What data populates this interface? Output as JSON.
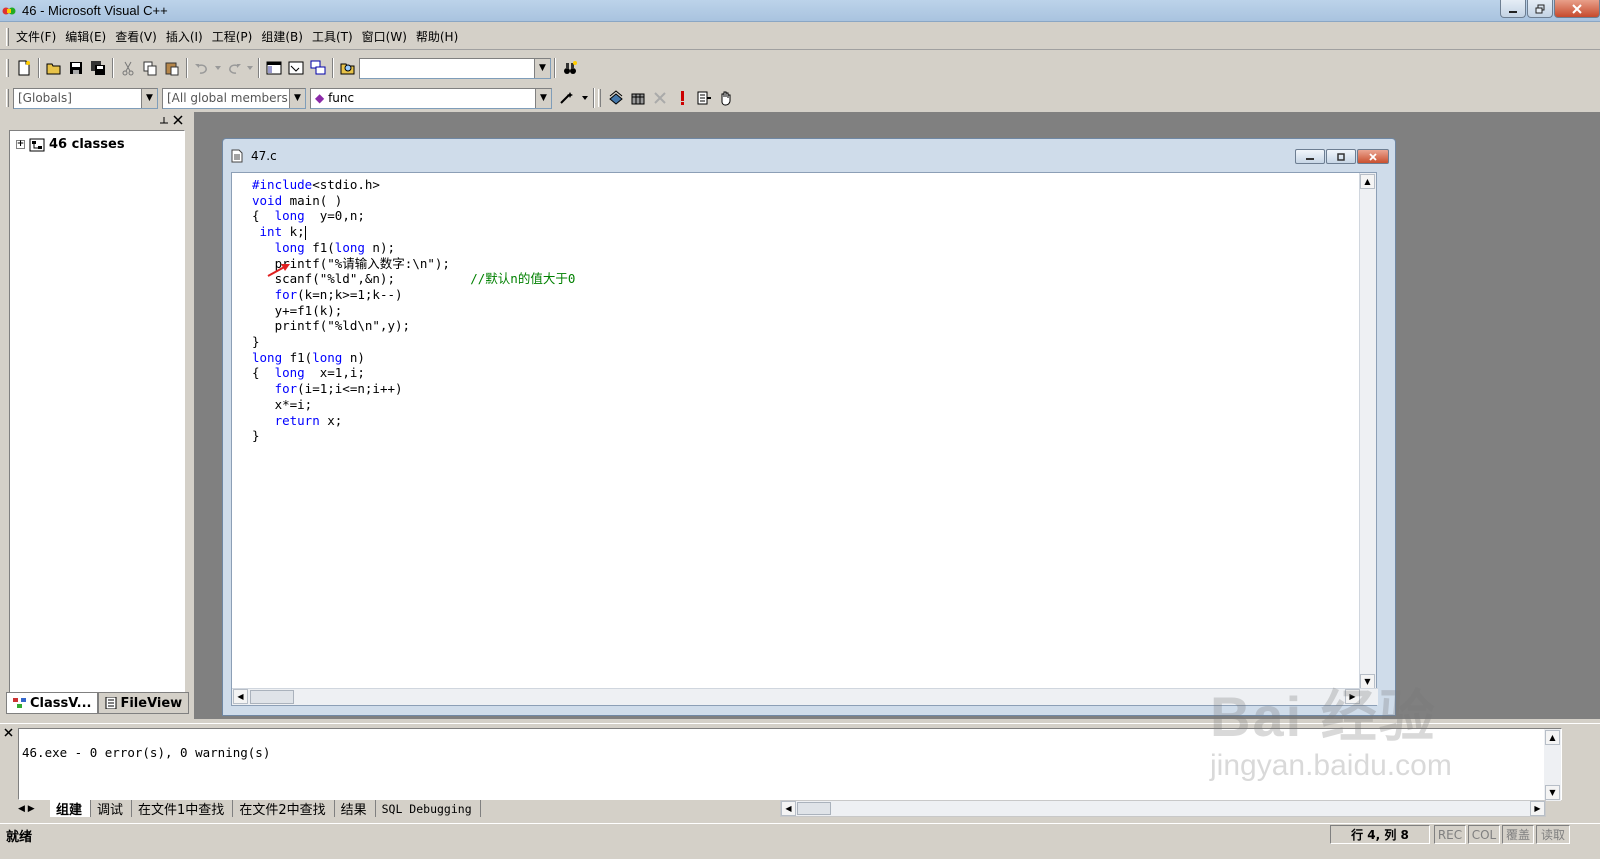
{
  "window": {
    "title": "46 - Microsoft Visual C++"
  },
  "menu": [
    "文件(F)",
    "编辑(E)",
    "查看(V)",
    "插入(I)",
    "工程(P)",
    "组建(B)",
    "工具(T)",
    "窗口(W)",
    "帮助(H)"
  ],
  "wizard": {
    "scope": "[Globals]",
    "filter": "[All global members",
    "member": "func"
  },
  "workspace": {
    "tree_root": "46 classes",
    "tabs": [
      "ClassV...",
      "FileView"
    ],
    "active_tab": "ClassV..."
  },
  "editor": {
    "file": "47.c"
  },
  "code_lines": [
    {
      "seg": [
        {
          "t": "#include",
          "k": "kw"
        },
        {
          "t": "<stdio.h>"
        }
      ]
    },
    {
      "seg": [
        {
          "t": "void",
          "k": "kw"
        },
        {
          "t": " main( )"
        }
      ]
    },
    {
      "seg": [
        {
          "t": "{  "
        },
        {
          "t": "long",
          "k": "kw"
        },
        {
          "t": "  y=0,n;"
        }
      ]
    },
    {
      "seg": [
        {
          "t": " "
        },
        {
          "t": "int",
          "k": "kw"
        },
        {
          "t": " k;"
        }
      ],
      "cursor": true
    },
    {
      "seg": [
        {
          "t": "   "
        },
        {
          "t": "long",
          "k": "kw"
        },
        {
          "t": " f1("
        },
        {
          "t": "long",
          "k": "kw"
        },
        {
          "t": " n);"
        }
      ]
    },
    {
      "seg": [
        {
          "t": "   printf(\"%请输入数字:\\n\");"
        }
      ]
    },
    {
      "seg": [
        {
          "t": "   scanf(\"%ld\",&n);          "
        },
        {
          "t": "//默认n的值大于0",
          "k": "cm"
        }
      ]
    },
    {
      "seg": [
        {
          "t": "   "
        },
        {
          "t": "for",
          "k": "kw"
        },
        {
          "t": "(k=n;k>=1;k--)"
        }
      ]
    },
    {
      "seg": [
        {
          "t": "   y+=f1(k);"
        }
      ]
    },
    {
      "seg": [
        {
          "t": "   printf(\"%ld\\n\",y);"
        }
      ]
    },
    {
      "seg": [
        {
          "t": "}"
        }
      ]
    },
    {
      "seg": [
        {
          "t": "long",
          "k": "kw"
        },
        {
          "t": " f1("
        },
        {
          "t": "long",
          "k": "kw"
        },
        {
          "t": " n)"
        }
      ]
    },
    {
      "seg": [
        {
          "t": "{  "
        },
        {
          "t": "long",
          "k": "kw"
        },
        {
          "t": "  x=1,i;"
        }
      ]
    },
    {
      "seg": [
        {
          "t": "   "
        },
        {
          "t": "for",
          "k": "kw"
        },
        {
          "t": "(i=1;i<=n;i++)"
        }
      ]
    },
    {
      "seg": [
        {
          "t": "   x*=i;"
        }
      ]
    },
    {
      "seg": [
        {
          "t": "   "
        },
        {
          "t": "return",
          "k": "kw"
        },
        {
          "t": " x;"
        }
      ]
    },
    {
      "seg": [
        {
          "t": "}"
        }
      ]
    }
  ],
  "output": {
    "message": "46.exe - 0 error(s), 0 warning(s)",
    "tabs": [
      "组建",
      "调试",
      "在文件1中查找",
      "在文件2中查找",
      "结果",
      "SQL Debugging"
    ],
    "active_tab": "组建"
  },
  "status": {
    "text": "就绪",
    "position": "行 4, 列 8",
    "indicators": [
      "REC",
      "COL",
      "覆盖",
      "读取"
    ]
  },
  "watermark": {
    "main": "Bai 经验",
    "sub": "jingyan.baidu.com"
  },
  "colors": {
    "keyword": "#0000ff",
    "comment": "#008000",
    "annotation_arrow": "#e02020"
  }
}
